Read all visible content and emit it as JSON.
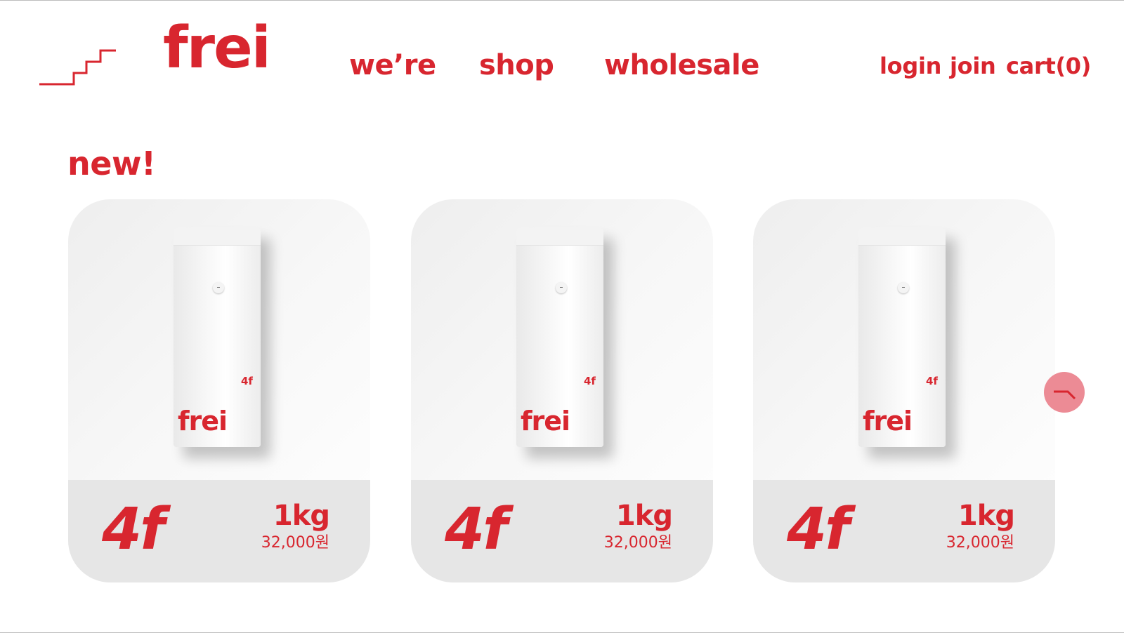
{
  "header": {
    "logo": "frei",
    "stairs_icon": "stairs-icon",
    "nav": {
      "were": "we’re",
      "shop": "shop",
      "wholesale": "wholesale"
    },
    "account": {
      "login": "login",
      "join": "join",
      "cart": "cart(0)"
    }
  },
  "section": {
    "title": "new!"
  },
  "products": [
    {
      "bag_code": "4f",
      "bag_brand": "frei",
      "code": "4f",
      "weight": "1kg",
      "price": "32,000원"
    },
    {
      "bag_code": "4f",
      "bag_brand": "frei",
      "code": "4f",
      "weight": "1kg",
      "price": "32,000원"
    },
    {
      "bag_code": "4f",
      "bag_brand": "frei",
      "code": "4f",
      "weight": "1kg",
      "price": "32,000원"
    }
  ],
  "carousel": {
    "next_icon": "arrow-right-icon"
  },
  "colors": {
    "brand_red": "#d8262f",
    "button_pink": "#ec8b95",
    "card_footer": "#e6e6e6"
  }
}
